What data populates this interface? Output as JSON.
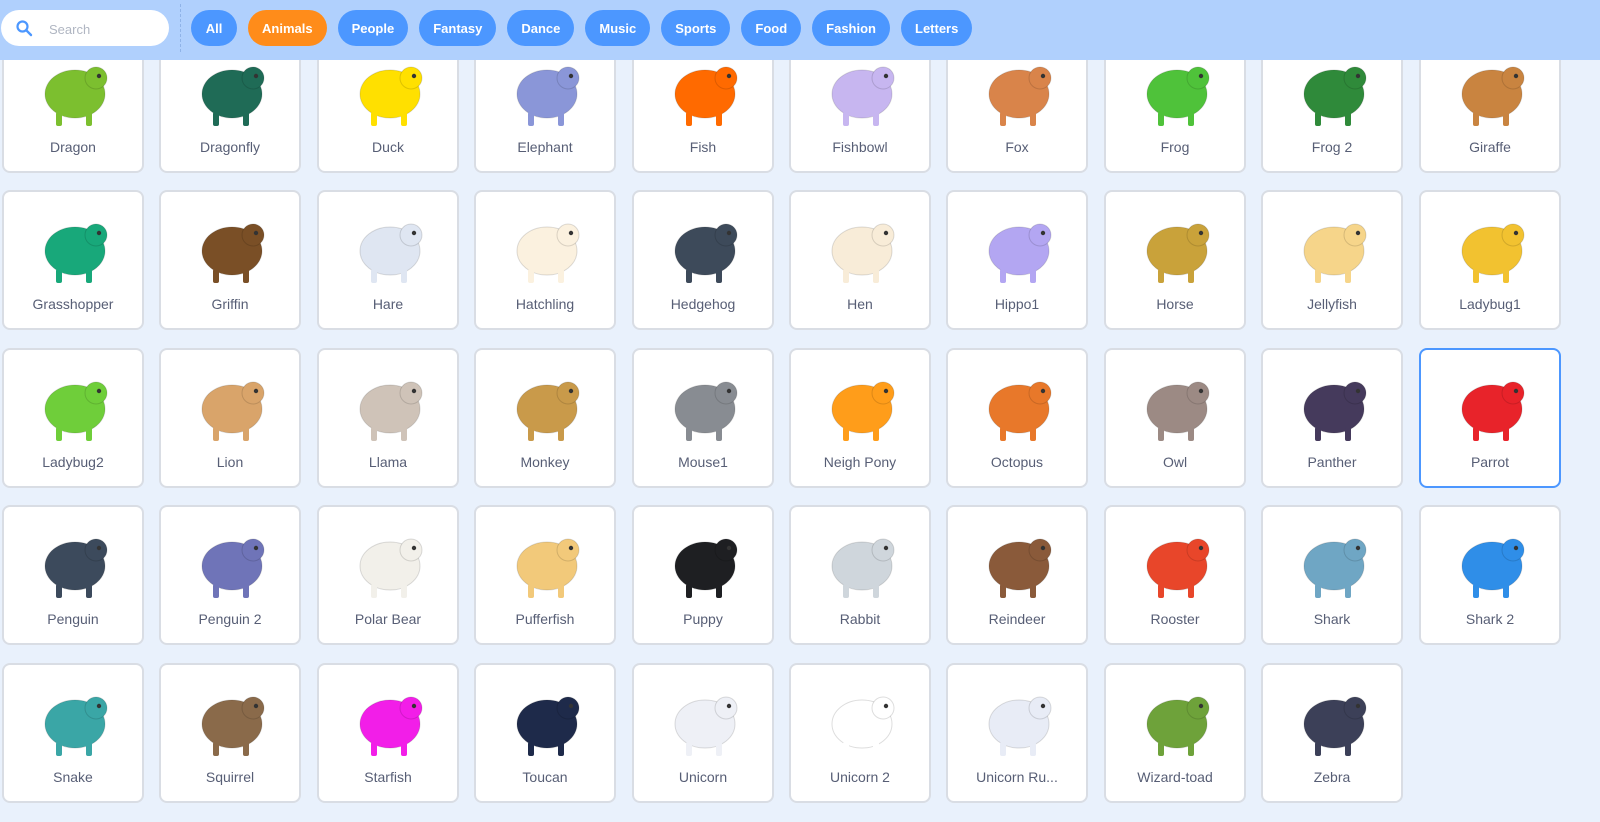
{
  "search": {
    "placeholder": "Search",
    "value": ""
  },
  "tags": [
    {
      "label": "All",
      "active": false
    },
    {
      "label": "Animals",
      "active": true
    },
    {
      "label": "People",
      "active": false
    },
    {
      "label": "Fantasy",
      "active": false
    },
    {
      "label": "Dance",
      "active": false
    },
    {
      "label": "Music",
      "active": false
    },
    {
      "label": "Sports",
      "active": false
    },
    {
      "label": "Food",
      "active": false
    },
    {
      "label": "Fashion",
      "active": false
    },
    {
      "label": "Letters",
      "active": false
    }
  ],
  "colors": {
    "header_bg": "#b0d0fd",
    "tag": "#4c97ff",
    "tag_active": "#ff8c1a",
    "page_bg": "#e9f1fc",
    "selected_border": "#4c97ff",
    "label_text": "#575e75"
  },
  "sprites": [
    {
      "name": "Dragon",
      "icon": "dragon-icon",
      "color": "#7cbf2f"
    },
    {
      "name": "Dragonfly",
      "icon": "dragonfly-icon",
      "color": "#1f6b56"
    },
    {
      "name": "Duck",
      "icon": "duck-icon",
      "color": "#ffe000"
    },
    {
      "name": "Elephant",
      "icon": "elephant-icon",
      "color": "#8a96d8"
    },
    {
      "name": "Fish",
      "icon": "fish-icon",
      "color": "#ff6a00"
    },
    {
      "name": "Fishbowl",
      "icon": "fishbowl-icon",
      "color": "#c7b6f0"
    },
    {
      "name": "Fox",
      "icon": "fox-icon",
      "color": "#d9844a"
    },
    {
      "name": "Frog",
      "icon": "frog-icon",
      "color": "#4fc23a"
    },
    {
      "name": "Frog 2",
      "icon": "frog-icon",
      "color": "#2f8a3a"
    },
    {
      "name": "Giraffe",
      "icon": "giraffe-icon",
      "color": "#c98440"
    },
    {
      "name": "Grasshopper",
      "icon": "grasshopper-icon",
      "color": "#18a87a"
    },
    {
      "name": "Griffin",
      "icon": "griffin-icon",
      "color": "#7a4f26"
    },
    {
      "name": "Hare",
      "icon": "hare-icon",
      "color": "#dfe6f2"
    },
    {
      "name": "Hatchling",
      "icon": "egg-icon",
      "color": "#fbf1df"
    },
    {
      "name": "Hedgehog",
      "icon": "hedgehog-icon",
      "color": "#3d4a5a"
    },
    {
      "name": "Hen",
      "icon": "hen-icon",
      "color": "#f8ecd8"
    },
    {
      "name": "Hippo1",
      "icon": "hippo-icon",
      "color": "#b3a6f2"
    },
    {
      "name": "Horse",
      "icon": "horse-icon",
      "color": "#c9a23a"
    },
    {
      "name": "Jellyfish",
      "icon": "jellyfish-icon",
      "color": "#f6d58a"
    },
    {
      "name": "Ladybug1",
      "icon": "ladybug-icon",
      "color": "#f2c230"
    },
    {
      "name": "Ladybug2",
      "icon": "ladybug-icon",
      "color": "#6fce3a"
    },
    {
      "name": "Lion",
      "icon": "lion-icon",
      "color": "#d9a46a"
    },
    {
      "name": "Llama",
      "icon": "llama-icon",
      "color": "#cfc3b8"
    },
    {
      "name": "Monkey",
      "icon": "monkey-icon",
      "color": "#c99a4a"
    },
    {
      "name": "Mouse1",
      "icon": "mouse-icon",
      "color": "#888c92"
    },
    {
      "name": "Neigh Pony",
      "icon": "pony-icon",
      "color": "#ff9d1a"
    },
    {
      "name": "Octopus",
      "icon": "octopus-icon",
      "color": "#e8782a"
    },
    {
      "name": "Owl",
      "icon": "owl-icon",
      "color": "#9c8a84"
    },
    {
      "name": "Panther",
      "icon": "panther-icon",
      "color": "#453a5c"
    },
    {
      "name": "Parrot",
      "icon": "parrot-icon",
      "color": "#e8232a",
      "selected": true
    },
    {
      "name": "Penguin",
      "icon": "penguin-icon",
      "color": "#3c4a5c"
    },
    {
      "name": "Penguin 2",
      "icon": "penguin-icon",
      "color": "#6f74b8"
    },
    {
      "name": "Polar Bear",
      "icon": "polar-bear-icon",
      "color": "#f2f0ea"
    },
    {
      "name": "Pufferfish",
      "icon": "pufferfish-icon",
      "color": "#f2c97a"
    },
    {
      "name": "Puppy",
      "icon": "puppy-icon",
      "color": "#1e1f22"
    },
    {
      "name": "Rabbit",
      "icon": "rabbit-icon",
      "color": "#cfd6dc"
    },
    {
      "name": "Reindeer",
      "icon": "reindeer-icon",
      "color": "#8a5a3a"
    },
    {
      "name": "Rooster",
      "icon": "rooster-icon",
      "color": "#e8462a"
    },
    {
      "name": "Shark",
      "icon": "shark-icon",
      "color": "#6fa6c4"
    },
    {
      "name": "Shark 2",
      "icon": "shark-icon",
      "color": "#2f8ee8"
    },
    {
      "name": "Snake",
      "icon": "snake-icon",
      "color": "#3aa6a6"
    },
    {
      "name": "Squirrel",
      "icon": "squirrel-icon",
      "color": "#8a6a4a"
    },
    {
      "name": "Starfish",
      "icon": "starfish-icon",
      "color": "#f21ee8"
    },
    {
      "name": "Toucan",
      "icon": "toucan-icon",
      "color": "#1e2a4a"
    },
    {
      "name": "Unicorn",
      "icon": "unicorn-icon",
      "color": "#eef0f6"
    },
    {
      "name": "Unicorn 2",
      "icon": "unicorn-icon",
      "color": "#ffffff"
    },
    {
      "name": "Unicorn Ru...",
      "icon": "unicorn-icon",
      "color": "#e8ecf6"
    },
    {
      "name": "Wizard-toad",
      "icon": "wizard-toad-icon",
      "color": "#6ea23a"
    },
    {
      "name": "Zebra",
      "icon": "zebra-icon",
      "color": "#3c4058"
    }
  ]
}
